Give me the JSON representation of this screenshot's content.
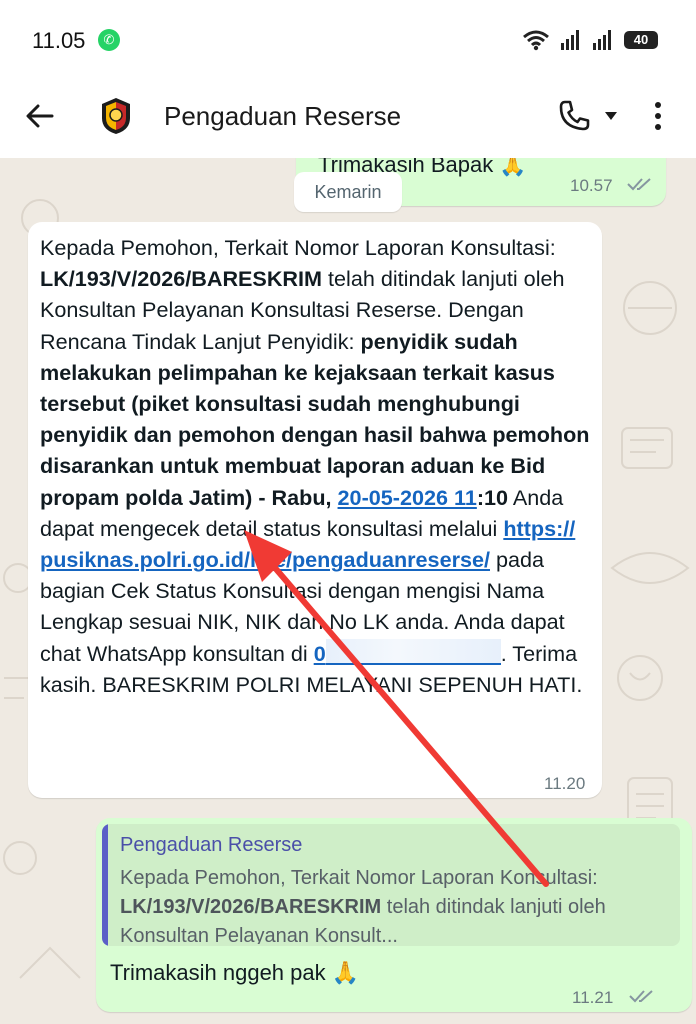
{
  "status_bar": {
    "time": "11.05",
    "battery": "40",
    "whatsapp_glyph": "✆"
  },
  "header": {
    "title": "Pengaduan Reserse"
  },
  "chat": {
    "prev_message": {
      "text": "Trimakasih Bapak 🙏",
      "time": "10.57"
    },
    "date_chip": "Kemarin",
    "incoming": {
      "t1": "Kepada Pemohon, Terkait Nomor Laporan Konsultasi: ",
      "b1": "LK/193/V/2026/BARESKRIM",
      "t2": " telah ditindak lanjuti oleh Konsultan Pelayanan Konsultasi Reserse. Dengan Rencana Tindak Lanjut Penyidik: ",
      "b2": "penyidik sudah melakukan pelimpahan ke kejaksaan terkait kasus tersebut (piket konsultasi sudah menghubungi penyidik dan pemohon  dengan hasil bahwa pemohon disarankan untuk membuat laporan aduan ke Bid propam polda Jatim) - Rabu, ",
      "date_link": "20-05-2026 11",
      "b3": ":10",
      "t3": " Anda dapat mengecek detail status konsultasi melalui ",
      "url": "https://​pusiknas.polri.go.id/live/pengaduanreserse/",
      "t4": " pada bagian Cek Status Konsultasi dengan mengisi Nama Lengkap sesuai NIK, NIK dan No LK anda. Anda dapat chat WhatsApp konsultan di ",
      "phone_partial": "0",
      "t5": ". Terima kasih. BARESKRIM POLRI MELAYANI SEPENUH HATI.",
      "time": "11.20"
    },
    "reply": {
      "quoted_sender": "Pengaduan Reserse",
      "quoted_t1": "Kepada Pemohon, Terkait Nomor Laporan Konsultasi: ",
      "quoted_b1": "LK/193/V/2026/BARESKRIM",
      "quoted_t2": " telah ditindak lanjuti oleh Konsultan Pelayanan Konsult...",
      "text": "Trimakasih nggeh pak 🙏",
      "time": "11.21"
    }
  },
  "colors": {
    "accent_link": "#1565c0",
    "annotation_arrow": "#f03a34",
    "outgoing_bubble": "#d9fdd3",
    "chat_background": "#efeae2"
  },
  "icons": [
    "back-arrow-icon",
    "police-badge-icon",
    "phone-icon",
    "dropdown-caret-icon",
    "more-vert-icon",
    "double-check-icon",
    "wifi-icon",
    "signal-icon",
    "battery-icon"
  ]
}
